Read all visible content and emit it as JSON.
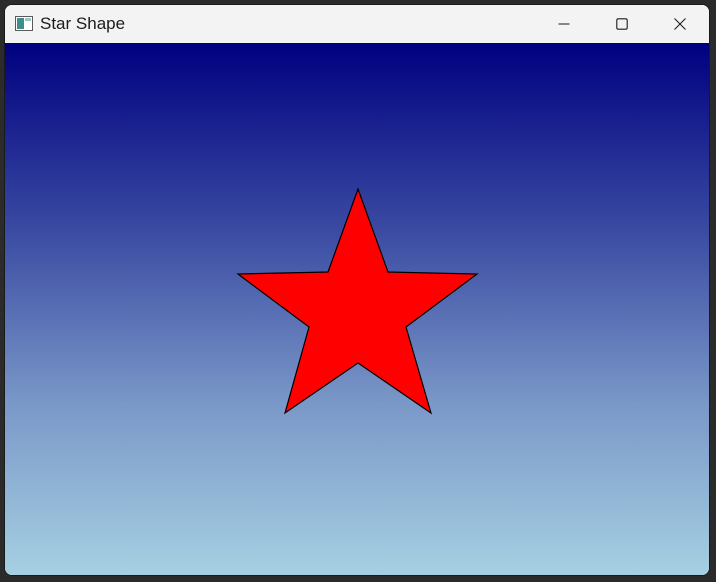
{
  "window": {
    "title": "Star Shape",
    "app_icon": "application-window-icon",
    "controls": {
      "minimize_icon": "minimize-icon",
      "maximize_icon": "maximize-icon",
      "close_icon": "close-icon"
    }
  },
  "canvas": {
    "background_gradient": [
      "#000080",
      "#a6d0e2"
    ],
    "shape": {
      "type": "star",
      "points": 5,
      "fill_color": "#ff0000",
      "stroke_color": "#000000"
    }
  }
}
